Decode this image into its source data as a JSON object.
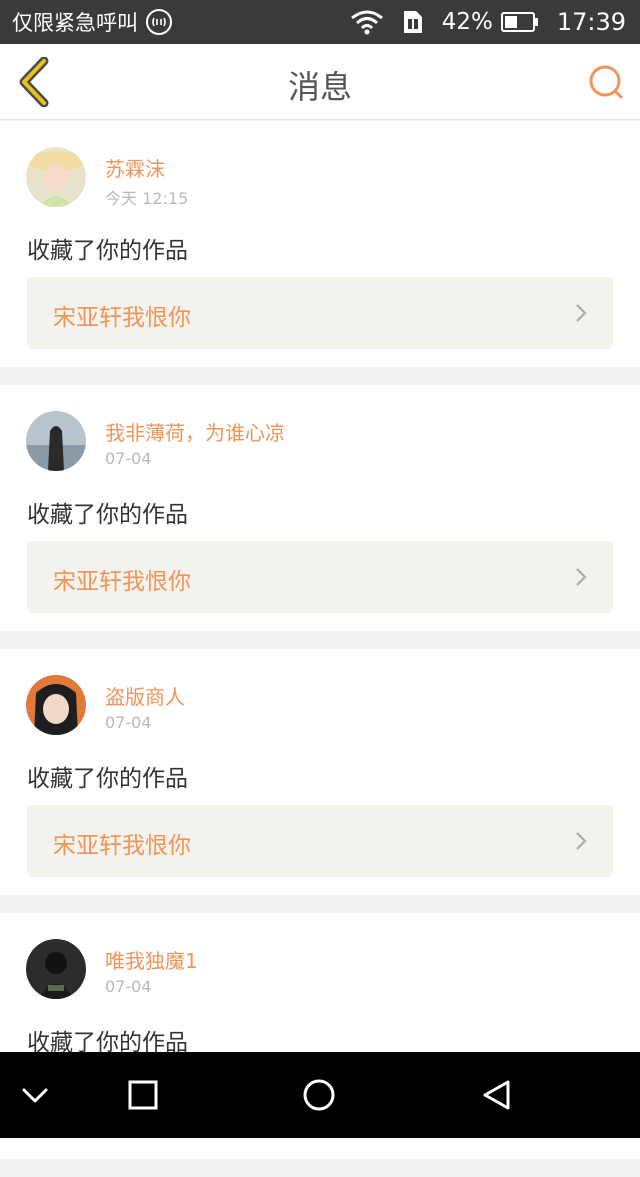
{
  "status_bar": {
    "carrier_text": "仅限紧急呼叫",
    "hd_icon": "hd-voice-icon",
    "battery_percent": "42%",
    "time": "17:39"
  },
  "header": {
    "title": "消息",
    "back_icon": "chevron-left-icon",
    "search_icon": "search-icon"
  },
  "colors": {
    "accent": "#f0955a",
    "back_icon": "#e8c31c"
  },
  "messages": [
    {
      "username": "苏霖沫",
      "time": "今天 12:15",
      "action": "收藏了你的作品",
      "work_title": "宋亚轩我恨你"
    },
    {
      "username": "我非薄荷，为谁心凉",
      "time": "07-04",
      "action": "收藏了你的作品",
      "work_title": "宋亚轩我恨你"
    },
    {
      "username": "盗版商人",
      "time": "07-04",
      "action": "收藏了你的作品",
      "work_title": "宋亚轩我恨你"
    },
    {
      "username": "唯我独魔1",
      "time": "07-04",
      "action": "收藏了你的作品",
      "work_title": ""
    }
  ],
  "nav_bar": {
    "icons": [
      "collapse-down-icon",
      "recents-square-icon",
      "home-circle-icon",
      "back-triangle-icon"
    ]
  }
}
